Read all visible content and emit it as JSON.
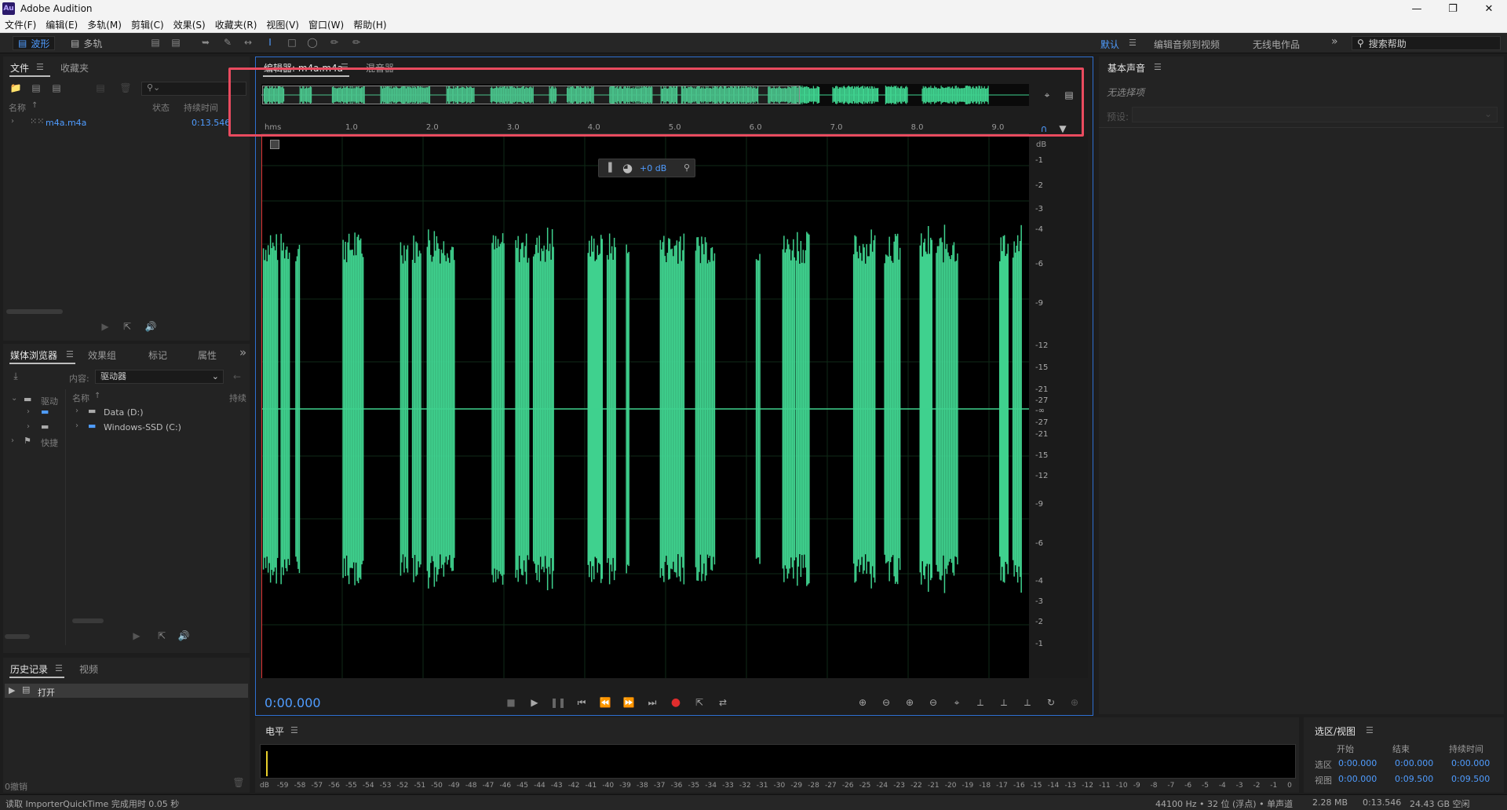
{
  "window": {
    "app_icon": "Au",
    "title": "Adobe Audition"
  },
  "menu": [
    "文件(F)",
    "编辑(E)",
    "多轨(M)",
    "剪辑(C)",
    "效果(S)",
    "收藏夹(R)",
    "视图(V)",
    "窗口(W)",
    "帮助(H)"
  ],
  "toolbar": {
    "waveform_label": "波形",
    "multitrack_label": "多轨",
    "workspaces": [
      "默认",
      "编辑音频到视频",
      "无线电作品"
    ],
    "search_placeholder": "搜索帮助"
  },
  "files_panel": {
    "tabs": [
      "文件",
      "收藏夹"
    ],
    "columns": {
      "name": "名称",
      "status": "状态",
      "duration": "持续时间"
    },
    "files": [
      {
        "name": "m4a.m4a",
        "duration": "0:13.546"
      }
    ]
  },
  "media_panel": {
    "tabs": [
      "媒体浏览器",
      "效果组",
      "标记",
      "属性"
    ],
    "content_label": "内容:",
    "content_value": "驱动器",
    "tree_left": [
      "驱动",
      "快捷"
    ],
    "name_header": "名称",
    "duration_header": "持续",
    "drives": [
      "Data (D:)",
      "Windows-SSD (C:)"
    ]
  },
  "history_panel": {
    "tabs": [
      "历史记录",
      "视频"
    ],
    "items": [
      "打开"
    ],
    "undo_count": "0撤销"
  },
  "editor": {
    "tab_label": "编辑器: m4a.m4a",
    "mixer_tab": "混音器",
    "hud_gain": "+0 dB",
    "time_display": "0:00.000",
    "ruler_unit": "hms",
    "ruler_ticks": [
      "1.0",
      "2.0",
      "3.0",
      "4.0",
      "5.0",
      "6.0",
      "7.0",
      "8.0",
      "9.0"
    ],
    "db_unit": "dB",
    "db_ticks_upper": [
      "-1",
      "-2",
      "-3",
      "-4",
      "-6",
      "-9",
      "-12",
      "-15",
      "-21",
      "-27"
    ],
    "db_center": "-∞",
    "db_ticks_lower": [
      "-27",
      "-21",
      "-15",
      "-12",
      "-9",
      "-6",
      "-4",
      "-3",
      "-2",
      "-1"
    ],
    "wave_color": "#3fd18e",
    "overview_view_fraction": 0.7
  },
  "right_panel": {
    "title": "基本声音",
    "no_selection": "无选择项",
    "preset_label": "预设:"
  },
  "level_panel": {
    "title": "电平",
    "scale": [
      "dB",
      "-59",
      "-58",
      "-57",
      "-56",
      "-55",
      "-54",
      "-53",
      "-52",
      "-51",
      "-50",
      "-49",
      "-48",
      "-47",
      "-46",
      "-45",
      "-44",
      "-43",
      "-42",
      "-41",
      "-40",
      "-39",
      "-38",
      "-37",
      "-36",
      "-35",
      "-34",
      "-33",
      "-32",
      "-31",
      "-30",
      "-29",
      "-28",
      "-27",
      "-26",
      "-25",
      "-24",
      "-23",
      "-22",
      "-21",
      "-20",
      "-19",
      "-18",
      "-17",
      "-16",
      "-15",
      "-14",
      "-13",
      "-12",
      "-11",
      "-10",
      "-9",
      "-8",
      "-7",
      "-6",
      "-5",
      "-4",
      "-3",
      "-2",
      "-1",
      "0"
    ]
  },
  "selection_panel": {
    "title": "选区/视图",
    "headers": [
      "开始",
      "结束",
      "持续时间"
    ],
    "rows": [
      {
        "label": "选区",
        "start": "0:00.000",
        "end": "0:00.000",
        "duration": "0:00.000"
      },
      {
        "label": "视图",
        "start": "0:00.000",
        "end": "0:09.500",
        "duration": "0:09.500"
      }
    ]
  },
  "status": {
    "message": "读取 ImporterQuickTime 完成用时 0.05 秒",
    "format": "44100 Hz • 32 位 (浮点) • 单声道",
    "size": "2.28 MB",
    "duration": "0:13.546",
    "free": "24.43 GB 空闲"
  }
}
